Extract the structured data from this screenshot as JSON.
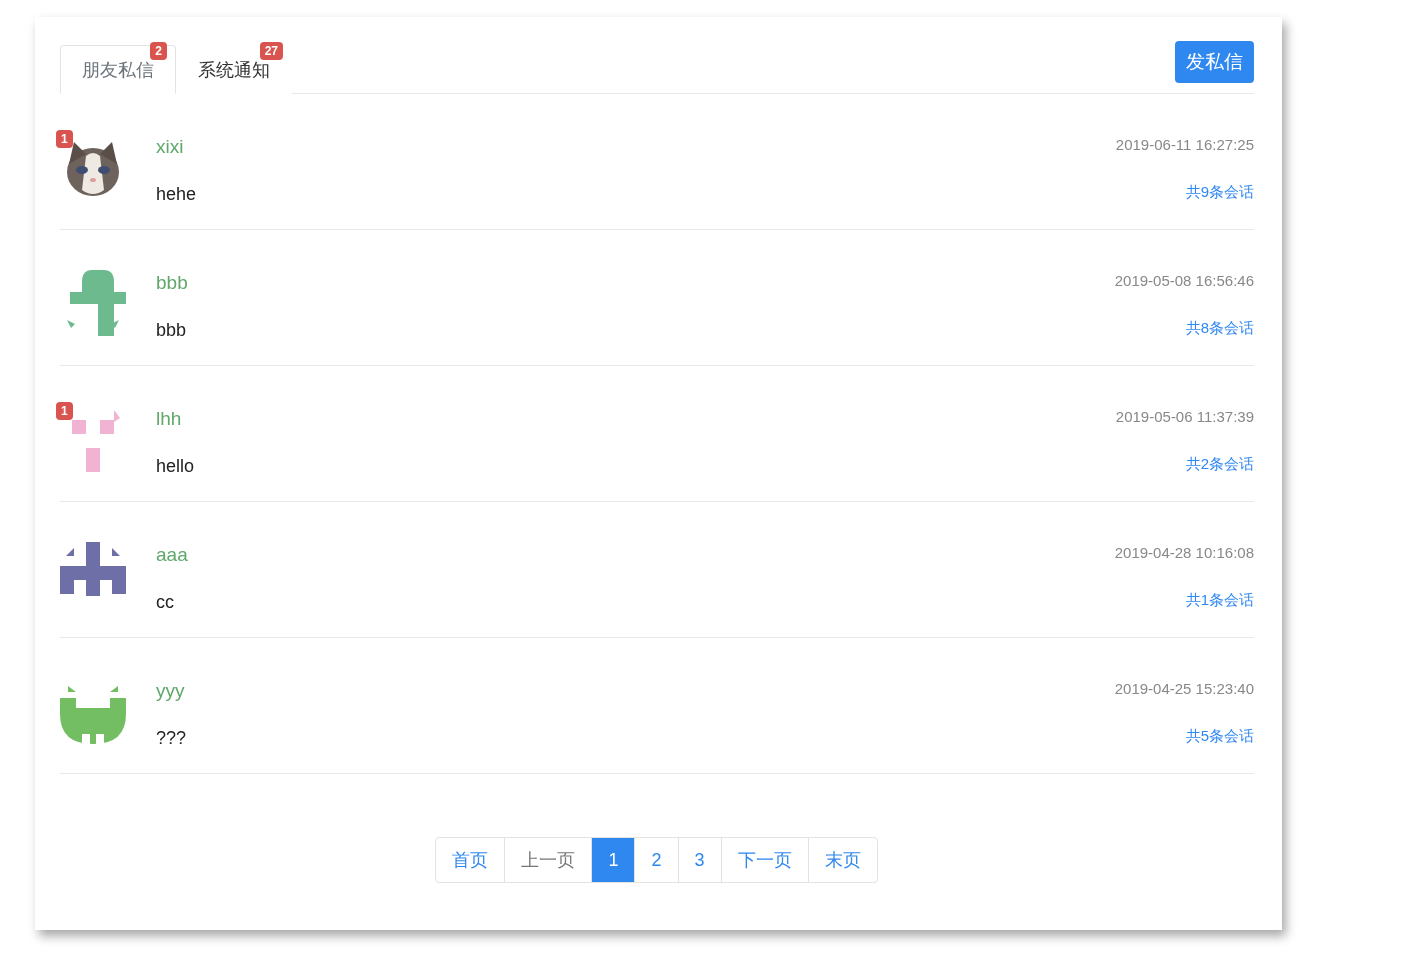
{
  "tabs": [
    {
      "label": "朋友私信",
      "badge": "2",
      "selected": true
    },
    {
      "label": "系统通知",
      "badge": "27",
      "selected": false
    }
  ],
  "send_button": "发私信",
  "conversations": [
    {
      "unread": "1",
      "name": "xixi",
      "message": "hehe",
      "time": "2019-06-11 16:27:25",
      "count": "共9条会话"
    },
    {
      "avatar": {
        "kind": "tower",
        "color": "#6dba8f"
      },
      "name": "bbb",
      "message": "bbb",
      "time": "2019-05-08 16:56:46",
      "count": "共8条会话"
    },
    {
      "avatar": {
        "kind": "pair",
        "color": "#f0b3d1"
      },
      "unread": "1",
      "name": "lhh",
      "message": "hello",
      "time": "2019-05-06 11:37:39",
      "count": "共2条会话"
    },
    {
      "avatar": {
        "kind": "cross",
        "color": "#6f6fa8"
      },
      "name": "aaa",
      "message": "cc",
      "time": "2019-04-28 10:16:08",
      "count": "共1条会话"
    },
    {
      "avatar": {
        "kind": "crab",
        "color": "#73be62"
      },
      "name": "yyy",
      "message": "???",
      "time": "2019-04-25 15:23:40",
      "count": "共5条会话"
    }
  ],
  "pagination": [
    {
      "label": "首页",
      "selected": false,
      "disabled": false
    },
    {
      "label": "上一页",
      "selected": false,
      "disabled": true
    },
    {
      "label": "1",
      "selected": true,
      "disabled": false
    },
    {
      "label": "2",
      "selected": false,
      "disabled": false
    },
    {
      "label": "3",
      "selected": false,
      "disabled": false
    },
    {
      "label": "下一页",
      "selected": false,
      "disabled": false
    },
    {
      "label": "末页",
      "selected": false,
      "disabled": false
    }
  ]
}
